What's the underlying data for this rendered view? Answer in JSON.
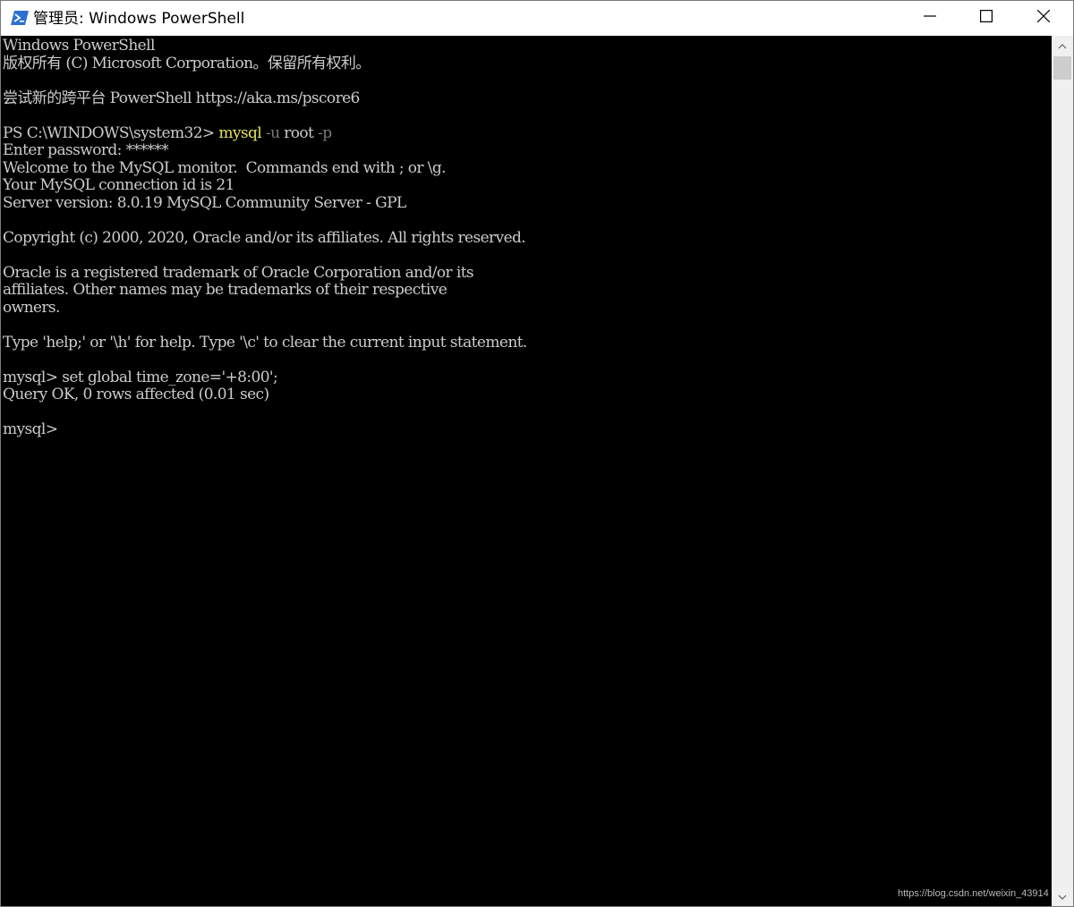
{
  "window": {
    "title": "管理员: Windows PowerShell",
    "icon": "powershell-icon",
    "controls": {
      "minimize": "minimize-icon",
      "maximize": "maximize-icon",
      "close": "close-icon"
    }
  },
  "console": {
    "lines": [
      {
        "text": "Windows PowerShell"
      },
      {
        "text": "版权所有 (C) Microsoft Corporation。保留所有权利。"
      },
      {
        "text": ""
      },
      {
        "text": "尝试新的跨平台 PowerShell https://aka.ms/pscore6"
      },
      {
        "text": ""
      },
      {
        "prompt": "PS C:\\WINDOWS\\system32> ",
        "command": "mysql",
        "arg1_flag": " -u",
        "arg1_value": " root",
        "arg2_flag": " -p"
      },
      {
        "text": "Enter password: ******"
      },
      {
        "text": "Welcome to the MySQL monitor.  Commands end with ; or \\g."
      },
      {
        "text": "Your MySQL connection id is 21"
      },
      {
        "text": "Server version: 8.0.19 MySQL Community Server - GPL"
      },
      {
        "text": ""
      },
      {
        "text": "Copyright (c) 2000, 2020, Oracle and/or its affiliates. All rights reserved."
      },
      {
        "text": ""
      },
      {
        "text": "Oracle is a registered trademark of Oracle Corporation and/or its"
      },
      {
        "text": "affiliates. Other names may be trademarks of their respective"
      },
      {
        "text": "owners."
      },
      {
        "text": ""
      },
      {
        "text": "Type 'help;' or '\\h' for help. Type '\\c' to clear the current input statement."
      },
      {
        "text": ""
      },
      {
        "text": "mysql> set global time_zone='+8:00';"
      },
      {
        "text": "Query OK, 0 rows affected (0.01 sec)"
      },
      {
        "text": ""
      },
      {
        "text": "mysql> "
      }
    ]
  },
  "scrollbar": {
    "up_icon": "chevron-up-icon",
    "down_icon": "chevron-down-icon"
  },
  "watermark": "https://blog.csdn.net/weixin_43914",
  "colors": {
    "console_bg": "#000000",
    "console_text": "#cccccc",
    "command_yellow": "#e5e05a",
    "param_gray": "#7a7a7a"
  }
}
